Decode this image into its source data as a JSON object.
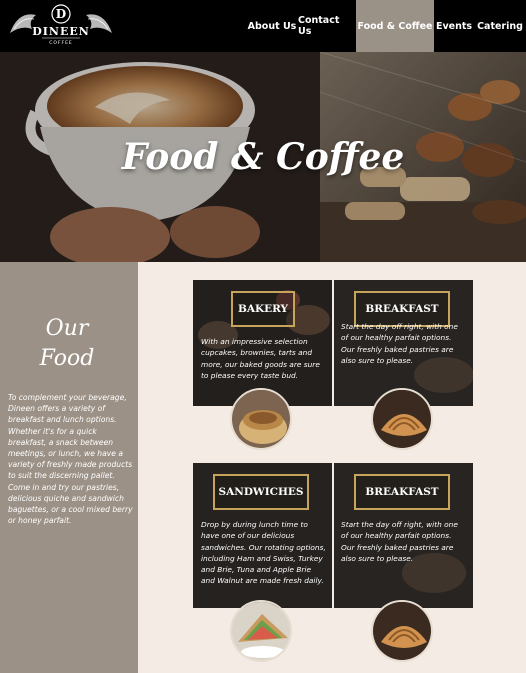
{
  "brand": {
    "name": "DINEEN",
    "sub": "COFFEE"
  },
  "nav": {
    "items": [
      "About Us",
      "Contact Us",
      "Food & Coffee",
      "Events",
      "Catering"
    ],
    "active": "Food & Coffee"
  },
  "hero": {
    "title": "Food & Coffee"
  },
  "intro": {
    "title_line1": "Our",
    "title_line2": "Food",
    "text": "To complement your beverage, Dineen offers a variety of breakfast and lunch options. Whether it's for a quick breakfast, a snack between meetings, or lunch, we have a variety of freshly made products to suit the discerning pallet. Come in and try our pastries, delicious quiche and sandwich baguettes, or a cool mixed berry or honey parfait."
  },
  "cards": [
    {
      "label": "BAKERY",
      "text": "With an impressive selection cupcakes, brownies, tarts and more, our baked goods are sure to please every taste bud."
    },
    {
      "label": "BREAKFAST",
      "text": "Start the day off right, with one of our healthy parfait options. Our freshly baked pastries are also sure to please."
    },
    {
      "label": "SANDWICHES",
      "text": "Drop by during lunch time to have one of our delicious sandwiches. Our rotating options, including Ham and Swiss, Turkey and Brie, Tuna and Apple Brie and Walnut are made fresh daily."
    },
    {
      "label": "BREAKFAST",
      "text": "Start the day off right, with one of our healthy parfait options. Our freshly baked pastries are also sure to please."
    }
  ],
  "colors": {
    "accent": "#c7a45b",
    "panel": "#9b9186",
    "background": "#f4ece4",
    "header": "#000000"
  }
}
